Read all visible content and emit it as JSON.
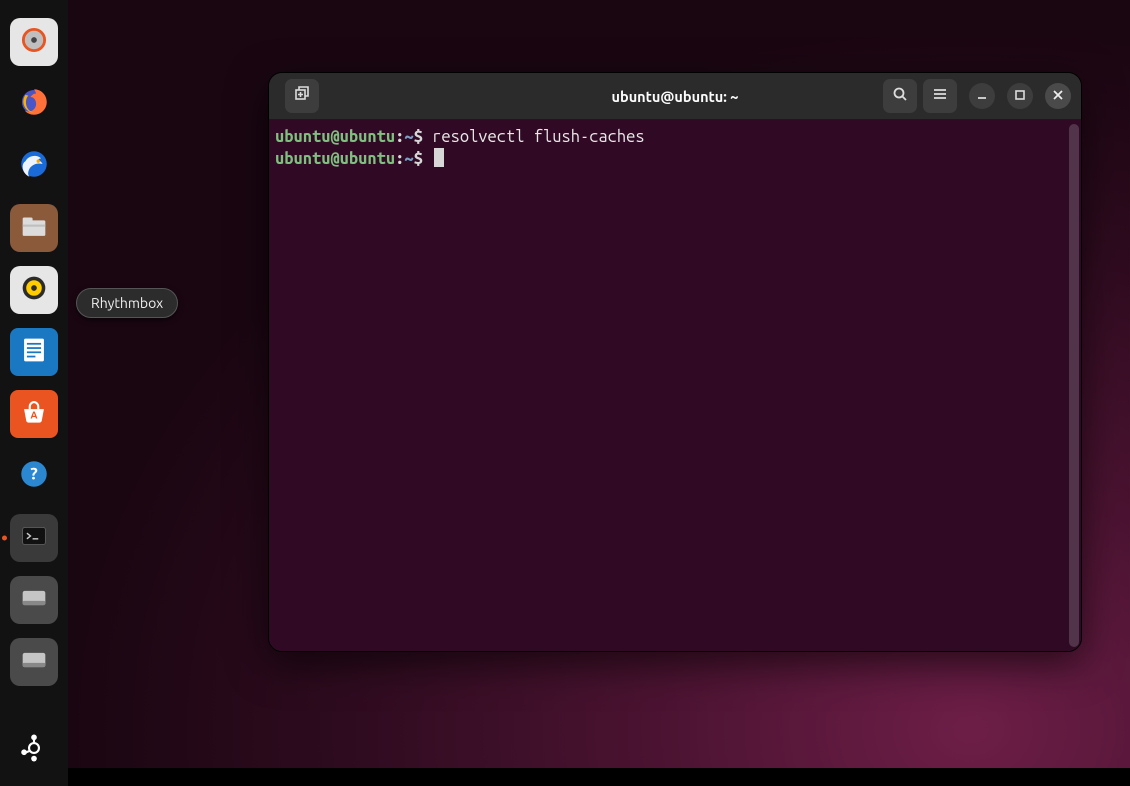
{
  "tooltip": {
    "text": "Rhythmbox"
  },
  "dock": {
    "items": [
      {
        "name": "disk-utility-icon"
      },
      {
        "name": "firefox-icon"
      },
      {
        "name": "thunderbird-icon"
      },
      {
        "name": "files-icon"
      },
      {
        "name": "rhythmbox-icon"
      },
      {
        "name": "libreoffice-writer-icon"
      },
      {
        "name": "ubuntu-software-icon"
      },
      {
        "name": "help-icon"
      },
      {
        "name": "terminal-icon"
      },
      {
        "name": "disk-1-icon"
      },
      {
        "name": "disk-2-icon"
      },
      {
        "name": "show-apps-icon"
      }
    ]
  },
  "terminal": {
    "title": "ubuntu@ubuntu: ~",
    "new_tab_name": "new-tab-button",
    "search_name": "search-button",
    "menu_name": "menu-button",
    "min_name": "minimize-button",
    "max_name": "maximize-button",
    "close_name": "close-button",
    "lines": [
      {
        "user": "ubuntu@ubuntu",
        "sep": ":",
        "path": "~",
        "dollar": "$ ",
        "cmd": "resolvectl flush-caches"
      },
      {
        "user": "ubuntu@ubuntu",
        "sep": ":",
        "path": "~",
        "dollar": "$ ",
        "cmd": "",
        "cursor": true
      }
    ]
  }
}
